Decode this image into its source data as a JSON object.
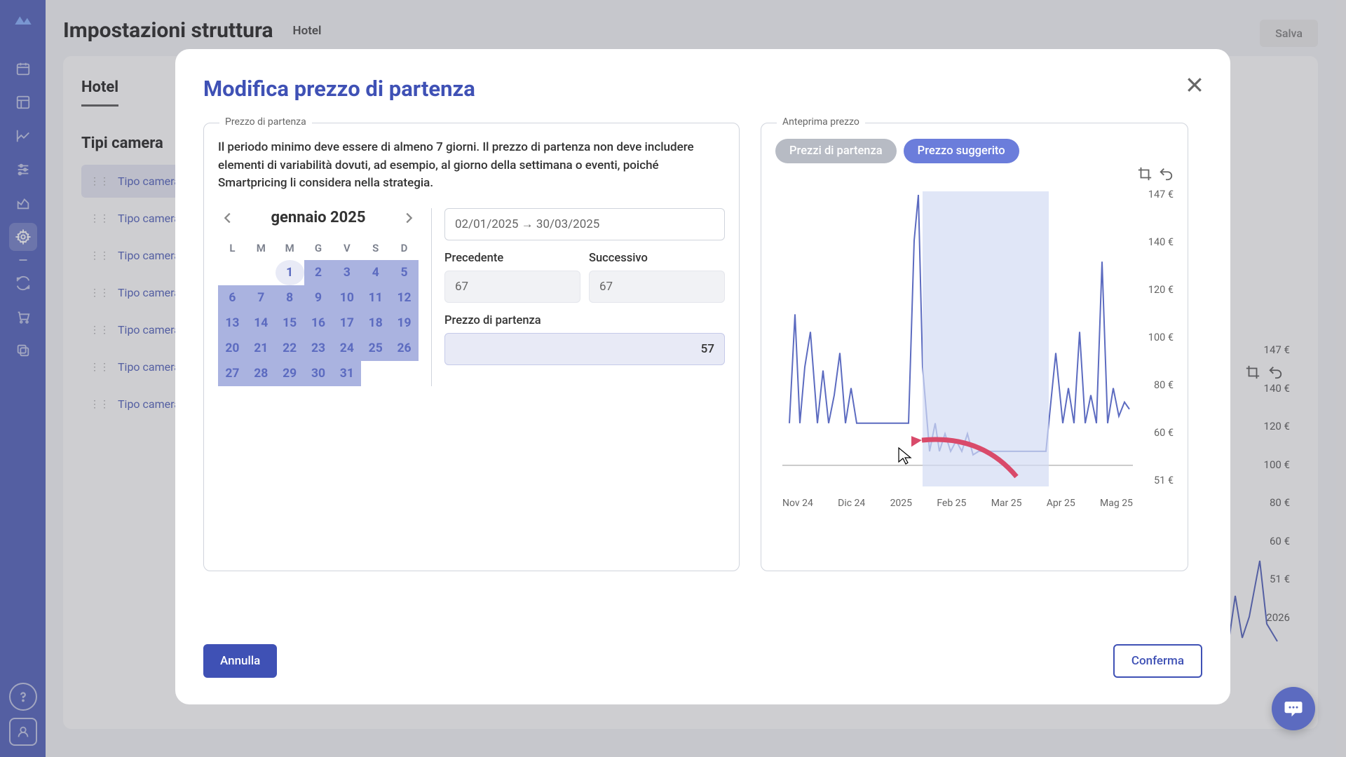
{
  "page": {
    "title": "Impostazioni struttura",
    "subtitle": "Hotel",
    "save": "Salva"
  },
  "panel": {
    "tab": "Hotel",
    "section": "Tipi camera"
  },
  "rooms": [
    "Tipo camera",
    "Tipo camera",
    "Tipo camera",
    "Tipo camera",
    "Tipo camera",
    "Tipo camera",
    "Tipo camera"
  ],
  "modal": {
    "title": "Modifica prezzo di partenza",
    "left_label": "Prezzo di partenza",
    "right_label": "Anteprima prezzo",
    "desc": "Il periodo minimo deve essere di almeno 7 giorni. Il prezzo di partenza non deve includere elementi di variabilità dovuti, ad esempio, al giorno della settimana o eventi, poiché Smartpricing li considera nella strategia.",
    "month": "gennaio 2025",
    "dow": [
      "L",
      "M",
      "M",
      "G",
      "V",
      "S",
      "D"
    ],
    "range": "02/01/2025 → 30/03/2025",
    "prev_label": "Precedente",
    "next_label": "Successivo",
    "prev_val": "67",
    "next_val": "67",
    "price_label": "Prezzo di partenza",
    "price_val": "57",
    "pill_a": "Prezzi di partenza",
    "pill_b": "Prezzo suggerito",
    "cancel": "Annulla",
    "confirm": "Conferma",
    "y_ticks": [
      "147 €",
      "140 €",
      "120 €",
      "100 €",
      "80 €",
      "60 €",
      "51 €"
    ],
    "x_ticks": [
      "Nov 24",
      "Dic 24",
      "2025",
      "Feb 25",
      "Mar 25",
      "Apr 25",
      "Mag 25"
    ]
  },
  "bg_chart": {
    "y": [
      "147 €",
      "140 €",
      "120 €",
      "100 €",
      "80 €",
      "60 €",
      "51 €"
    ],
    "x": "2026"
  },
  "chart_data": {
    "type": "line",
    "title": "Anteprima prezzo",
    "xlabel": "",
    "ylabel": "EUR",
    "ylim": [
      51,
      147
    ],
    "x": [
      "Nov 24",
      "Dic 24",
      "2025",
      "Feb 25",
      "Mar 25",
      "Apr 25",
      "Mag 25"
    ],
    "series": [
      {
        "name": "Prezzo suggerito",
        "values": [
          67,
          80,
          70,
          85,
          72,
          105,
          68,
          88,
          65,
          147,
          67,
          72,
          58,
          63,
          55,
          72,
          57,
          60,
          55,
          92,
          68,
          85,
          130,
          75,
          70
        ]
      }
    ],
    "highlight_range": [
      "Feb 25",
      "Mar 25"
    ]
  }
}
